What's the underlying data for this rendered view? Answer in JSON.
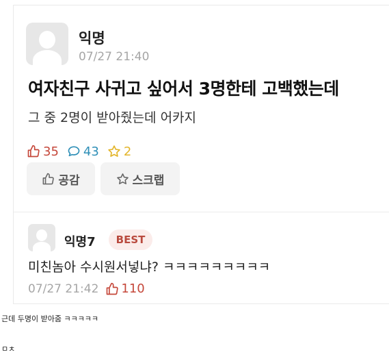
{
  "post": {
    "author": "익명",
    "time": "07/27 21:40",
    "title": "여자친구 사귀고 싶어서 3명한테 고백했는데",
    "body": "그 중 2명이 받아줬는데 어카지",
    "likes": "35",
    "comments": "43",
    "scraps": "2",
    "like_button": "공감",
    "scrap_button": "스크랩"
  },
  "comment": {
    "author": "익명7",
    "badge": "BEST",
    "text": "미친놈아 수시원서넣냐? ㅋㅋㅋㅋㅋㅋㅋㅋㅋ",
    "time": "07/27 21:42",
    "likes": "110"
  },
  "captions": {
    "line1": "근데 두명이 받아줌 ㅋㅋㅋㅋㅋ",
    "line2": "ㅁㅊ"
  },
  "colors": {
    "like_red": "#c5473a",
    "comment_blue": "#2e8fb7",
    "scrap_yellow": "#e3b52a",
    "muted_gray": "#a6a6a6",
    "badge_bg": "#fbecea"
  },
  "icons": {
    "avatar": "default-profile-icon",
    "like": "thumbs-up-icon",
    "comment": "speech-bubble-icon",
    "scrap": "star-icon"
  }
}
